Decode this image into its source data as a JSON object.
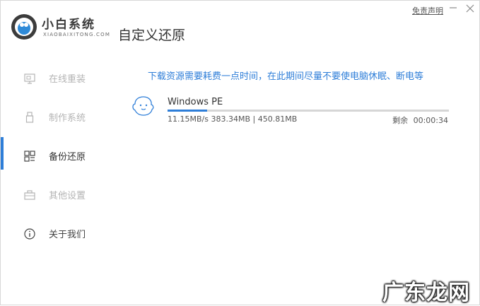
{
  "header": {
    "brand_name": "小白系统",
    "brand_sub": "XIAOBAIXITONG.COM",
    "page_title": "自定义还原",
    "disclaimer": "免责声明",
    "minimize_icon": "minimize-icon",
    "close_icon": "close-icon"
  },
  "sidebar": {
    "items": [
      {
        "label": "在线重装",
        "icon": "monitor-icon",
        "state": "disabled"
      },
      {
        "label": "制作系统",
        "icon": "usb-icon",
        "state": "disabled"
      },
      {
        "label": "备份还原",
        "icon": "grid-icon",
        "state": "active"
      },
      {
        "label": "其他设置",
        "icon": "toolbox-icon",
        "state": "disabled"
      },
      {
        "label": "关于我们",
        "icon": "info-icon",
        "state": "normal"
      }
    ]
  },
  "main": {
    "tip": "下载资源需要耗费一点时间，在此期间尽量不要使电脑休眠、断电等",
    "download": {
      "name": "Windows PE",
      "speed": "11.15MB/s",
      "downloaded": "383.34MB",
      "separator": "|",
      "total": "450.81MB",
      "remaining_label": "剩余",
      "remaining_time": "00:00:34",
      "progress_fraction": 0.14
    }
  },
  "watermark": "广东龙网",
  "colors": {
    "accent": "#2e7ed8",
    "muted": "#b4b4b4",
    "text": "#333333"
  }
}
